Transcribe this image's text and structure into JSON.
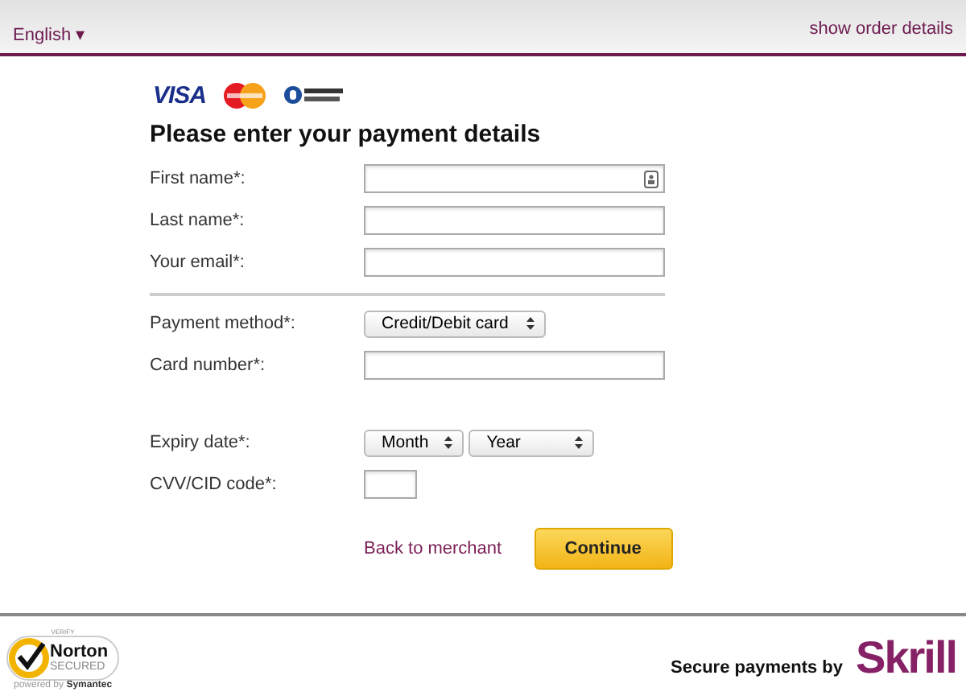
{
  "header": {
    "language": "English ▾",
    "order_link": "show order details"
  },
  "card_logos": {
    "visa": "VISA"
  },
  "title": "Please enter your payment details",
  "fields": [
    {
      "kind": "text",
      "label": "First name*:",
      "autofill_icon": true
    },
    {
      "kind": "text",
      "label": "Last name*:"
    },
    {
      "kind": "text",
      "label": "Your email*:"
    },
    {
      "kind": "divider"
    },
    {
      "kind": "select",
      "label": "Payment method*:",
      "options": [
        "Credit/Debit card"
      ]
    },
    {
      "kind": "text",
      "label": "Card number*:"
    },
    {
      "kind": "spacer"
    },
    {
      "kind": "select",
      "label": "Expiry date*:",
      "options": [
        "Month",
        "Year"
      ]
    },
    {
      "kind": "code",
      "label": "CVV/CID code*:"
    }
  ],
  "actions": {
    "back": "Back to merchant",
    "continue": "Continue"
  },
  "footer": {
    "norton": {
      "verify": "VERIFY",
      "name": "Norton",
      "secured": "SECURED",
      "powered": "powered by",
      "brand": "Symantec"
    },
    "secure_text": "Secure payments by",
    "skrill": "Skrill"
  }
}
